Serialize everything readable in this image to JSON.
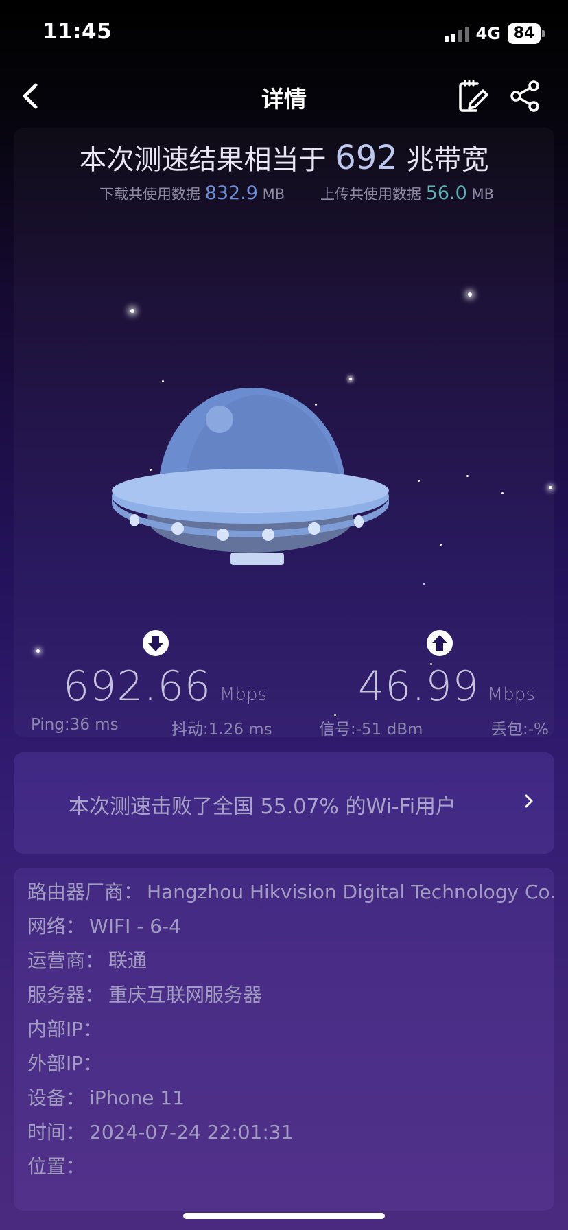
{
  "status_bar": {
    "time": "11:45",
    "network": "4G",
    "battery": "84"
  },
  "nav": {
    "title": "详情",
    "back_icon": "chevron-left-icon",
    "edit_icon": "edit-note-icon",
    "share_icon": "share-icon"
  },
  "result": {
    "headline_prefix": "本次测速结果相当于",
    "bandwidth": "692",
    "headline_suffix": "兆带宽",
    "download_usage_label": "下载共使用数据",
    "download_usage_value": "832.9",
    "download_usage_unit": "MB",
    "upload_usage_label": "上传共使用数据",
    "upload_usage_value": "56.0",
    "upload_usage_unit": "MB",
    "download_speed": "692.66",
    "upload_speed": "46.99",
    "speed_unit": "Mbps",
    "ping": "Ping:36 ms",
    "jitter": "抖动:1.26 ms",
    "signal": "信号:-51 dBm",
    "packet_loss": "丢包:-%"
  },
  "beat": {
    "text": "本次测速击败了全国 55.07% 的Wi-Fi用户"
  },
  "info": {
    "router_vendor_label": "路由器厂商：",
    "router_vendor": "Hangzhou Hikvision Digital Technology Co.,Ltd.",
    "network_label": "网络：",
    "network": "WIFI - 6-4",
    "carrier_label": "运营商：",
    "carrier": "联通",
    "server_label": "服务器：",
    "server": "重庆互联网服务器",
    "internal_ip_label": "内部IP：",
    "external_ip_label": "外部IP：",
    "device_label": "设备：",
    "device": "iPhone 11",
    "time_label": "时间：",
    "time": "2024-07-24 22:01:31",
    "location_label": "位置："
  },
  "colors": {
    "download_accent": "#6c8fd8",
    "upload_accent": "#5fb3b6",
    "ufo_dome": "#6a8fd0",
    "ufo_disc": "#8fb0e6"
  }
}
